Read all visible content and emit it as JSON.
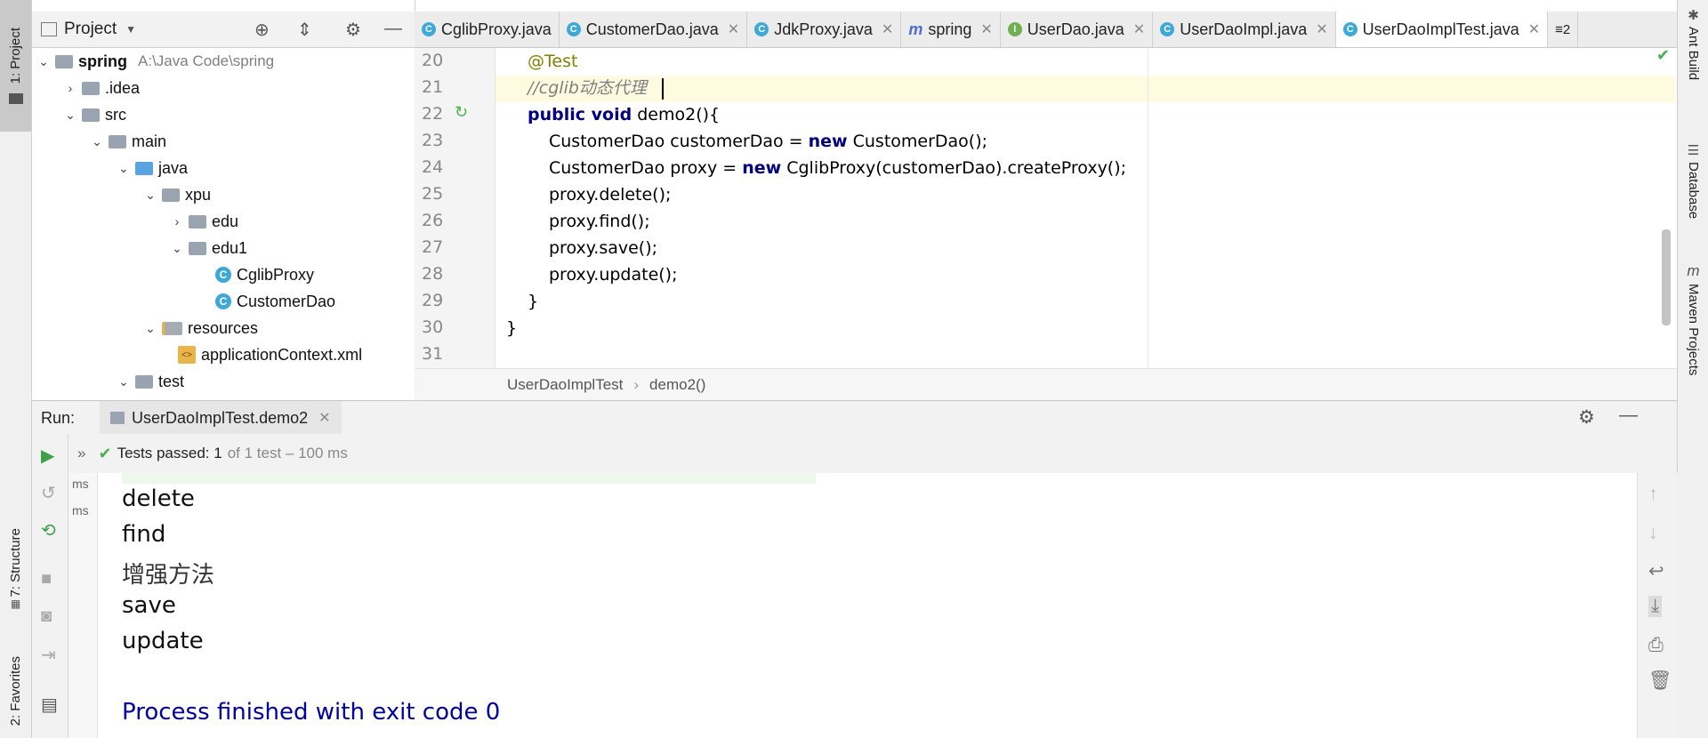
{
  "side_tabs": {
    "left": [
      "1: Project",
      "7: Structure",
      "2: Favorites"
    ],
    "right": [
      "Ant Build",
      "Database",
      "Maven Projects"
    ]
  },
  "project": {
    "title": "Project",
    "tree": [
      {
        "label": "spring",
        "extra": "A:\\Java Code\\spring"
      },
      {
        "label": ".idea"
      },
      {
        "label": "src"
      },
      {
        "label": "main"
      },
      {
        "label": "java"
      },
      {
        "label": "xpu"
      },
      {
        "label": "edu"
      },
      {
        "label": "edu1"
      },
      {
        "label": "CglibProxy"
      },
      {
        "label": "CustomerDao"
      },
      {
        "label": "resources"
      },
      {
        "label": "applicationContext.xml"
      },
      {
        "label": "test"
      }
    ]
  },
  "editor": {
    "tabs": [
      {
        "label": "CglibProxy.java",
        "icon": "C"
      },
      {
        "label": "CustomerDao.java",
        "icon": "C"
      },
      {
        "label": "JdkProxy.java",
        "icon": "C"
      },
      {
        "label": "spring",
        "icon": "m"
      },
      {
        "label": "UserDao.java",
        "icon": "I"
      },
      {
        "label": "UserDaoImpl.java",
        "icon": "C"
      },
      {
        "label": "UserDaoImplTest.java",
        "icon": "C"
      }
    ],
    "tab_overflow": "≡2",
    "line_numbers": [
      "20",
      "21",
      "22",
      "23",
      "24",
      "25",
      "26",
      "27",
      "28",
      "29",
      "30",
      "31"
    ],
    "code": {
      "l20": "@Test",
      "l21": "//cglib动态代理",
      "l22_kw": "public void",
      "l22_rest": " demo2(){",
      "l23_a": "CustomerDao customerDao = ",
      "l23_kw": "new",
      "l23_b": " CustomerDao();",
      "l24_a": "CustomerDao proxy = ",
      "l24_kw": "new",
      "l24_b": " CglibProxy(customerDao).createProxy();",
      "l25": "proxy.delete();",
      "l26": "proxy.find();",
      "l27": "proxy.save();",
      "l28": "proxy.update();",
      "l29": "}",
      "l30": "}"
    },
    "breadcrumb": [
      "UserDaoImplTest",
      "demo2()"
    ]
  },
  "run": {
    "label": "Run:",
    "tab": "UserDaoImplTest.demo2",
    "status_bold": "Tests passed: 1",
    "status_rest": "of 1 test – 100 ms",
    "tree_ms": [
      "ms",
      "ms"
    ],
    "output": [
      "delete",
      "find",
      "增强方法",
      "save",
      "update",
      "Process finished with exit code 0"
    ]
  }
}
